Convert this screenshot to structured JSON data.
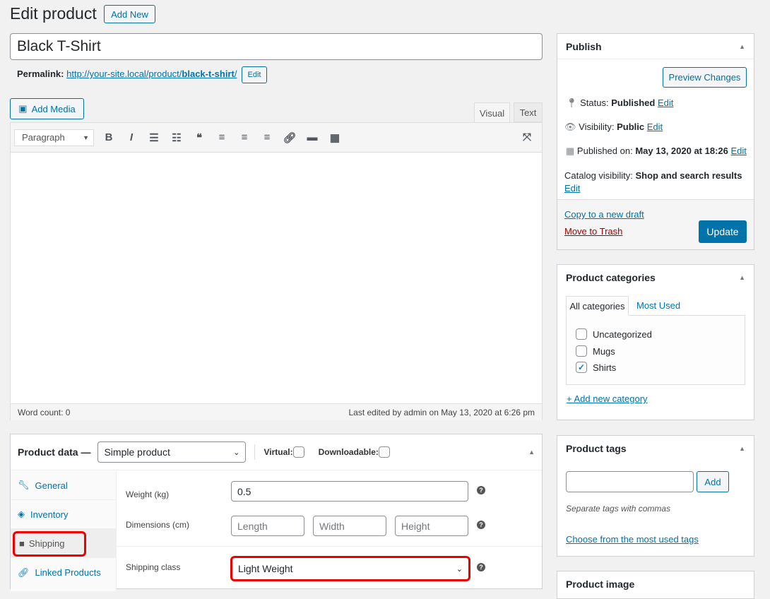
{
  "header": {
    "title": "Edit product",
    "add_new": "Add New"
  },
  "post": {
    "title": "Black T-Shirt",
    "permalink_label": "Permalink:",
    "permalink_base": "http://your-site.local/product/",
    "permalink_slug": "black-t-shirt",
    "permalink_end": "/",
    "edit": "Edit"
  },
  "editor": {
    "add_media": "Add Media",
    "tab_visual": "Visual",
    "tab_text": "Text",
    "format": "Paragraph",
    "word_count": "Word count: 0",
    "last_edited": "Last edited by admin on May 13, 2020 at 6:26 pm"
  },
  "product_data": {
    "label": "Product data —",
    "type": "Simple product",
    "virtual": "Virtual:",
    "downloadable": "Downloadable:",
    "tabs": [
      {
        "label": "General",
        "icon": "wrench-icon"
      },
      {
        "label": "Inventory",
        "icon": "tag-icon"
      },
      {
        "label": "Shipping",
        "icon": "truck-icon"
      },
      {
        "label": "Linked Products",
        "icon": "link-icon"
      }
    ],
    "weight_label": "Weight (kg)",
    "weight": "0.5",
    "dimensions_label": "Dimensions (cm)",
    "length_ph": "Length",
    "width_ph": "Width",
    "height_ph": "Height",
    "shipping_class_label": "Shipping class",
    "shipping_class": "Light Weight"
  },
  "publish": {
    "title": "Publish",
    "preview": "Preview Changes",
    "status_label": "Status:",
    "status": "Published",
    "visibility_label": "Visibility:",
    "visibility": "Public",
    "published_label": "Published on:",
    "published": "May 13, 2020 at 18:26",
    "catalog_label": "Catalog visibility:",
    "catalog": "Shop and search results",
    "edit": "Edit",
    "copy": "Copy to a new draft",
    "trash": "Move to Trash",
    "update": "Update"
  },
  "categories": {
    "title": "Product categories",
    "tab_all": "All categories",
    "tab_most": "Most Used",
    "items": [
      {
        "label": "Uncategorized",
        "checked": false
      },
      {
        "label": "Mugs",
        "checked": false
      },
      {
        "label": "Shirts",
        "checked": true
      }
    ],
    "add": "+ Add new category"
  },
  "tags": {
    "title": "Product tags",
    "add": "Add",
    "hint": "Separate tags with commas",
    "choose": "Choose from the most used tags"
  },
  "image": {
    "title": "Product image"
  },
  "colors": {
    "primary": "#0073aa",
    "highlight": "#ee0000"
  }
}
